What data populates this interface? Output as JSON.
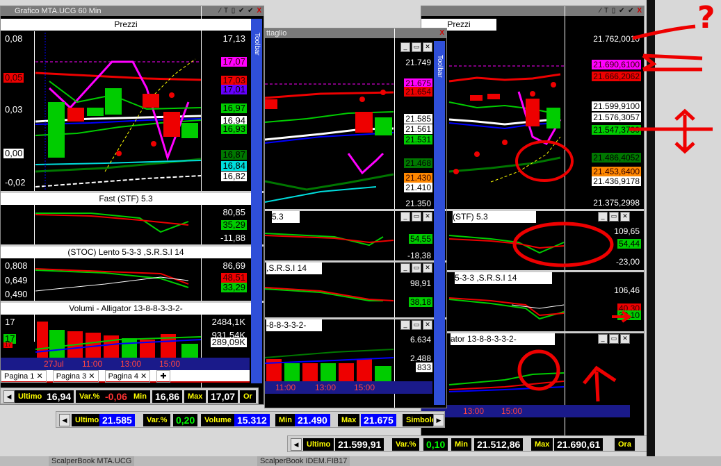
{
  "windows": {
    "w1": {
      "title": "Grafico MTA.UCG 60 Min",
      "panels": {
        "price_title": "Prezzi",
        "fast_title": "Fast  (STF)   5.3",
        "stoc_title": "(STOC) Lento    5-3-3  ,S.R.S.I 14",
        "vol_title": "Volumi - Alligator 13-8-8-3-3-2-"
      },
      "price_left": [
        "0,08",
        "0,05",
        "0,03",
        "0,00",
        "-0,02"
      ],
      "price_right": [
        "17,13",
        "17,07",
        "17,03",
        "17,01",
        "16,97",
        "16,94",
        "16,93",
        "16,87",
        "16,84",
        "16,82"
      ],
      "fast_right": [
        "80,85",
        "35,29",
        "-11,88"
      ],
      "stoc_left": [
        "0,808",
        "0,649",
        "0,490"
      ],
      "stoc_right": [
        "86,69",
        "48,51",
        "33,29"
      ],
      "vol_left": [
        "17",
        "17",
        "17"
      ],
      "vol_right": [
        "2484,1K",
        "931,54K",
        "289,09K"
      ],
      "time": [
        "27Jul",
        "11:00",
        "13:00",
        "15:00"
      ],
      "tabs": [
        "Pagina 1",
        "Pagina 3",
        "Pagina 4"
      ],
      "status": {
        "ultimo_label": "Ultimo",
        "ultimo": "16,94",
        "var_label": "Var.%",
        "var": "-0,06",
        "min_label": "Min",
        "min": "16,86",
        "max_label": "Max",
        "max": "17,07",
        "ora_label": "Or"
      }
    },
    "w2": {
      "title": "ttaglio",
      "toolbar": "Toolbar",
      "price_right": [
        "21.749",
        "21.675",
        "21.654",
        "21.585",
        "21.561",
        "21.531",
        "21.468",
        "21.430",
        "21.410",
        "21.350"
      ],
      "fast_title": "5.3",
      "fast_right": [
        "54,55",
        "-18,38"
      ],
      "stoc_title": ",S.R.S.I 14",
      "stoc_right": [
        "98,91",
        "38,18"
      ],
      "vol_title": "-8-8-3-3-2-",
      "vol_right": [
        "6.634",
        "2.488",
        "833"
      ],
      "time": [
        "11:00",
        "13:00",
        "15:00"
      ],
      "status": {
        "ultimo_label": "Ultimo",
        "ultimo": "21.585",
        "var_label": "Var.%",
        "var": "0,20",
        "vol_label": "Volume",
        "vol": "15.312",
        "min_label": "Min",
        "min": "21.490",
        "max_label": "Max",
        "max": "21.675",
        "sim_label": "Simbolo"
      }
    },
    "w3": {
      "price_title": "Prezzi",
      "price_right": [
        "21.762,0010",
        "21.690,6100",
        "21.666,2062",
        "21.599,9100",
        "21.576,3057",
        "21.547,3730",
        "21.486,4052",
        "21.453,6400",
        "21.436,9178",
        "21.375,2998"
      ],
      "fast_title": "(STF)   5.3",
      "fast_right": [
        "109,65",
        "54,44",
        "-23,00"
      ],
      "stoc_title": "5-3-3  ,S.R.S.I 14",
      "stoc_right": [
        "106,46",
        "40,30",
        "32,10"
      ],
      "vol_title": "ator 13-8-8-3-3-2-",
      "time": [
        "13:00",
        "15:00"
      ],
      "status": {
        "ultimo_label": "Ultimo",
        "ultimo": "21.599,91",
        "var_label": "Var.%",
        "var": "0,10",
        "min_label": "Min",
        "min": "21.512,86",
        "max_label": "Max",
        "max": "21.690,61",
        "ora_label": "Ora"
      }
    }
  },
  "annotation": {
    "question": "?"
  },
  "taskbar": [
    "ScalperBook MTA.UCG",
    "ScalperBook IDEM.FIB17"
  ],
  "colors": {
    "bg": "#000000",
    "title": "#7a7a7a",
    "accent_red": "#ee0000",
    "accent_green": "#00cc00",
    "panel": "#ffffff"
  }
}
